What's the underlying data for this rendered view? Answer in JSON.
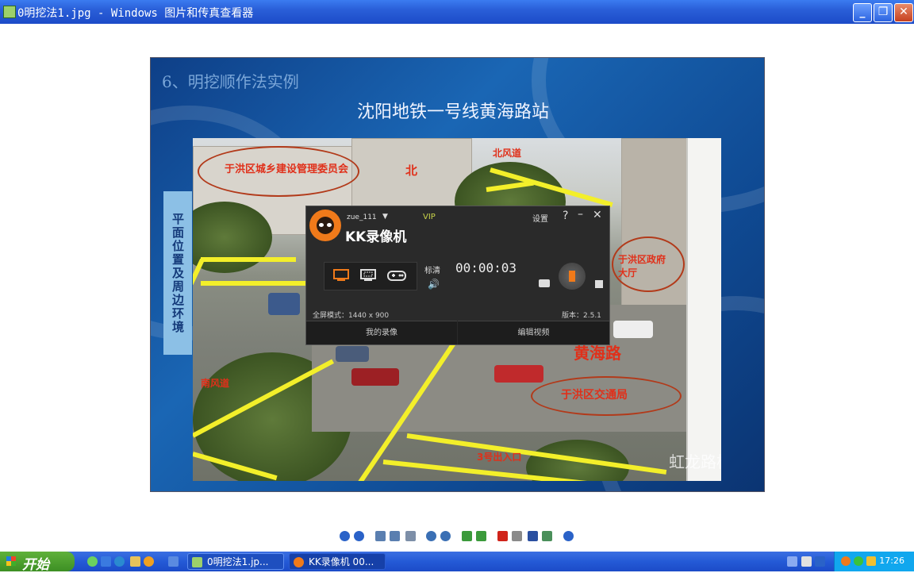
{
  "window": {
    "title": "0明挖法1.jpg - Windows 图片和传真查看器",
    "minimize_glyph": "_",
    "maximize_glyph": "❐",
    "close_glyph": "✕"
  },
  "slide": {
    "heading": "6、明挖顺作法实例",
    "subtitle": "沈阳地铁一号线黄海路站",
    "side_label": "平面位置及周边环境",
    "photo_labels": {
      "top_left_bubble": "于洪区城乡建设管理委员会",
      "north": "北",
      "north_wind": "北风道",
      "right_bubble": "于洪区政府大厅",
      "road_name": "黄海路",
      "traffic_bubble": "于洪区交通局",
      "entrance_3": "3号出入口",
      "south_wind": "南风道",
      "watermark": "虹龙路桥"
    }
  },
  "kk_recorder": {
    "user": "zue_111",
    "vip": "VIP",
    "settings": "设置",
    "help": "?",
    "minimize": "–",
    "close": "✕",
    "brand": "KK录像机",
    "quality": "标清",
    "volume_icon": "🔊",
    "timer": "00:00:03",
    "fullscreen_info": "全屏模式：1440 x 900",
    "version": "版本：2.5.1",
    "tab_my_recordings": "我的录像",
    "tab_edit_video": "编辑视频"
  },
  "taskbar": {
    "start_label": "开始",
    "tasks": [
      "0明挖法1.jp...",
      "KK录像机 00..."
    ],
    "clock": "17:26"
  },
  "colors": {
    "titlebar_blue": "#2a5fd8",
    "slide_blue": "#1a66b4",
    "yellow_lines": "#f3ef2a",
    "kk_orange": "#f07a1a",
    "start_green": "#3d8f24",
    "tray_blue": "#11a7ee"
  }
}
